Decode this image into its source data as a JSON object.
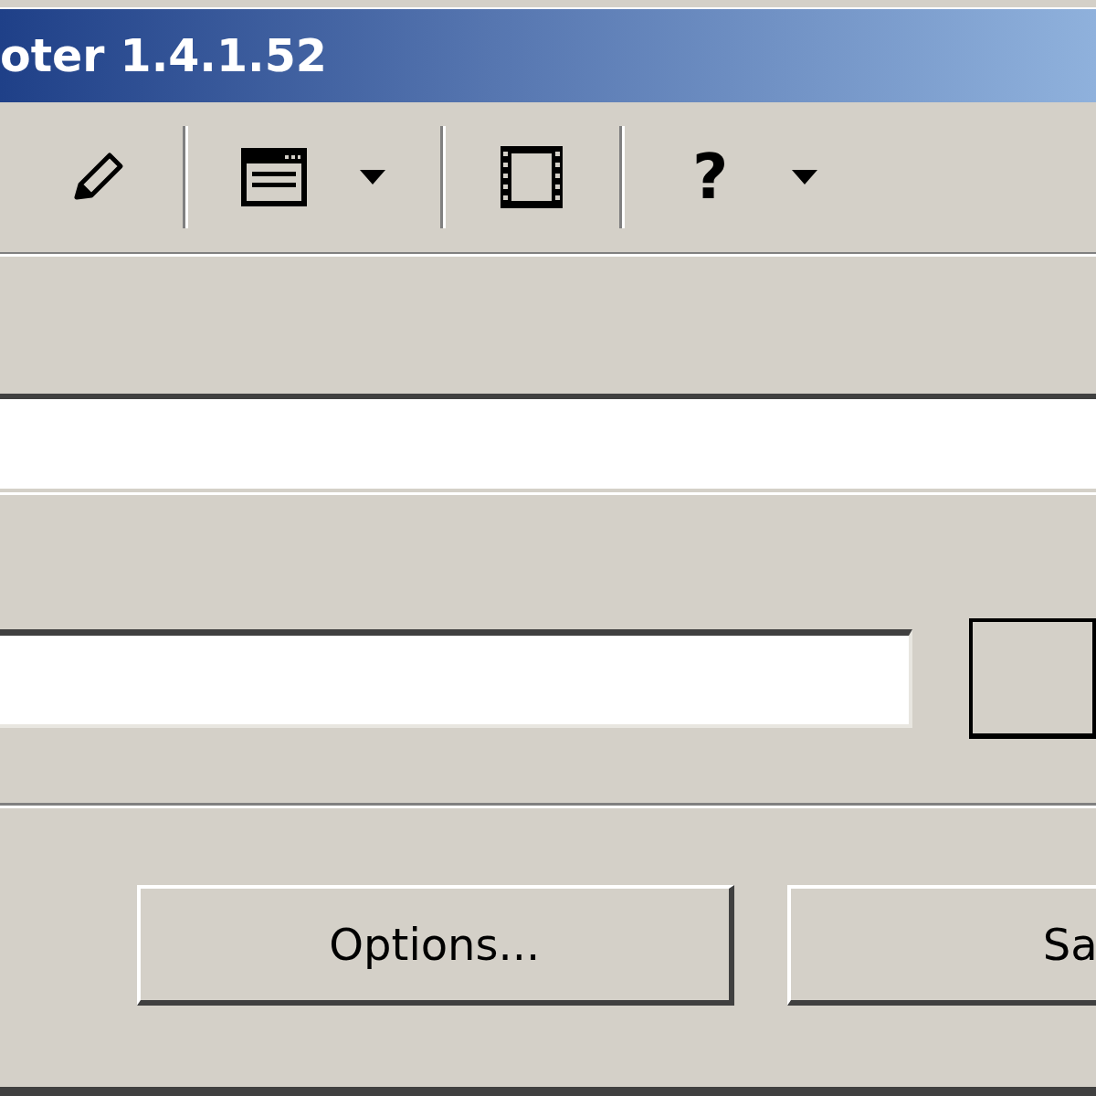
{
  "window": {
    "title": "oter 1.4.1.52"
  },
  "toolbar": {
    "help_label": "?"
  },
  "side_button": {
    "default": true
  },
  "buttons": [
    {
      "label": "Options..."
    },
    {
      "label": "Sa"
    }
  ]
}
